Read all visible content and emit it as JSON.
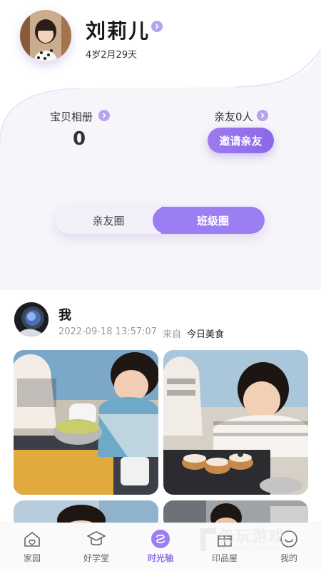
{
  "profile": {
    "name": "刘莉儿",
    "age": "4岁2月29天"
  },
  "stats": {
    "album_label": "宝贝相册",
    "album_count": "0",
    "friends_label": "亲友0人",
    "invite_label": "邀请亲友"
  },
  "segment": {
    "left_label": "亲友圈",
    "right_label": "班级圈",
    "active": "班级圈"
  },
  "post": {
    "user": "我",
    "timestamp": "2022-09-18 13:57:07",
    "from_label": "来自",
    "source": "今日美食"
  },
  "tabbar": {
    "items": [
      {
        "label": "家园",
        "icon": "home-icon"
      },
      {
        "label": "好学堂",
        "icon": "graduation-cap-icon"
      },
      {
        "label": "时光轴",
        "icon": "timeline-icon"
      },
      {
        "label": "印品屋",
        "icon": "gift-box-icon"
      },
      {
        "label": "我的",
        "icon": "smiley-user-icon"
      }
    ],
    "active_index": 2
  },
  "watermark": {
    "text": "仍玩游戏",
    "sub": "Rengwan Games"
  },
  "colors": {
    "accent": "#9b7ff2",
    "accent_dark": "#8a68e8",
    "background": "#f6f5f9"
  }
}
